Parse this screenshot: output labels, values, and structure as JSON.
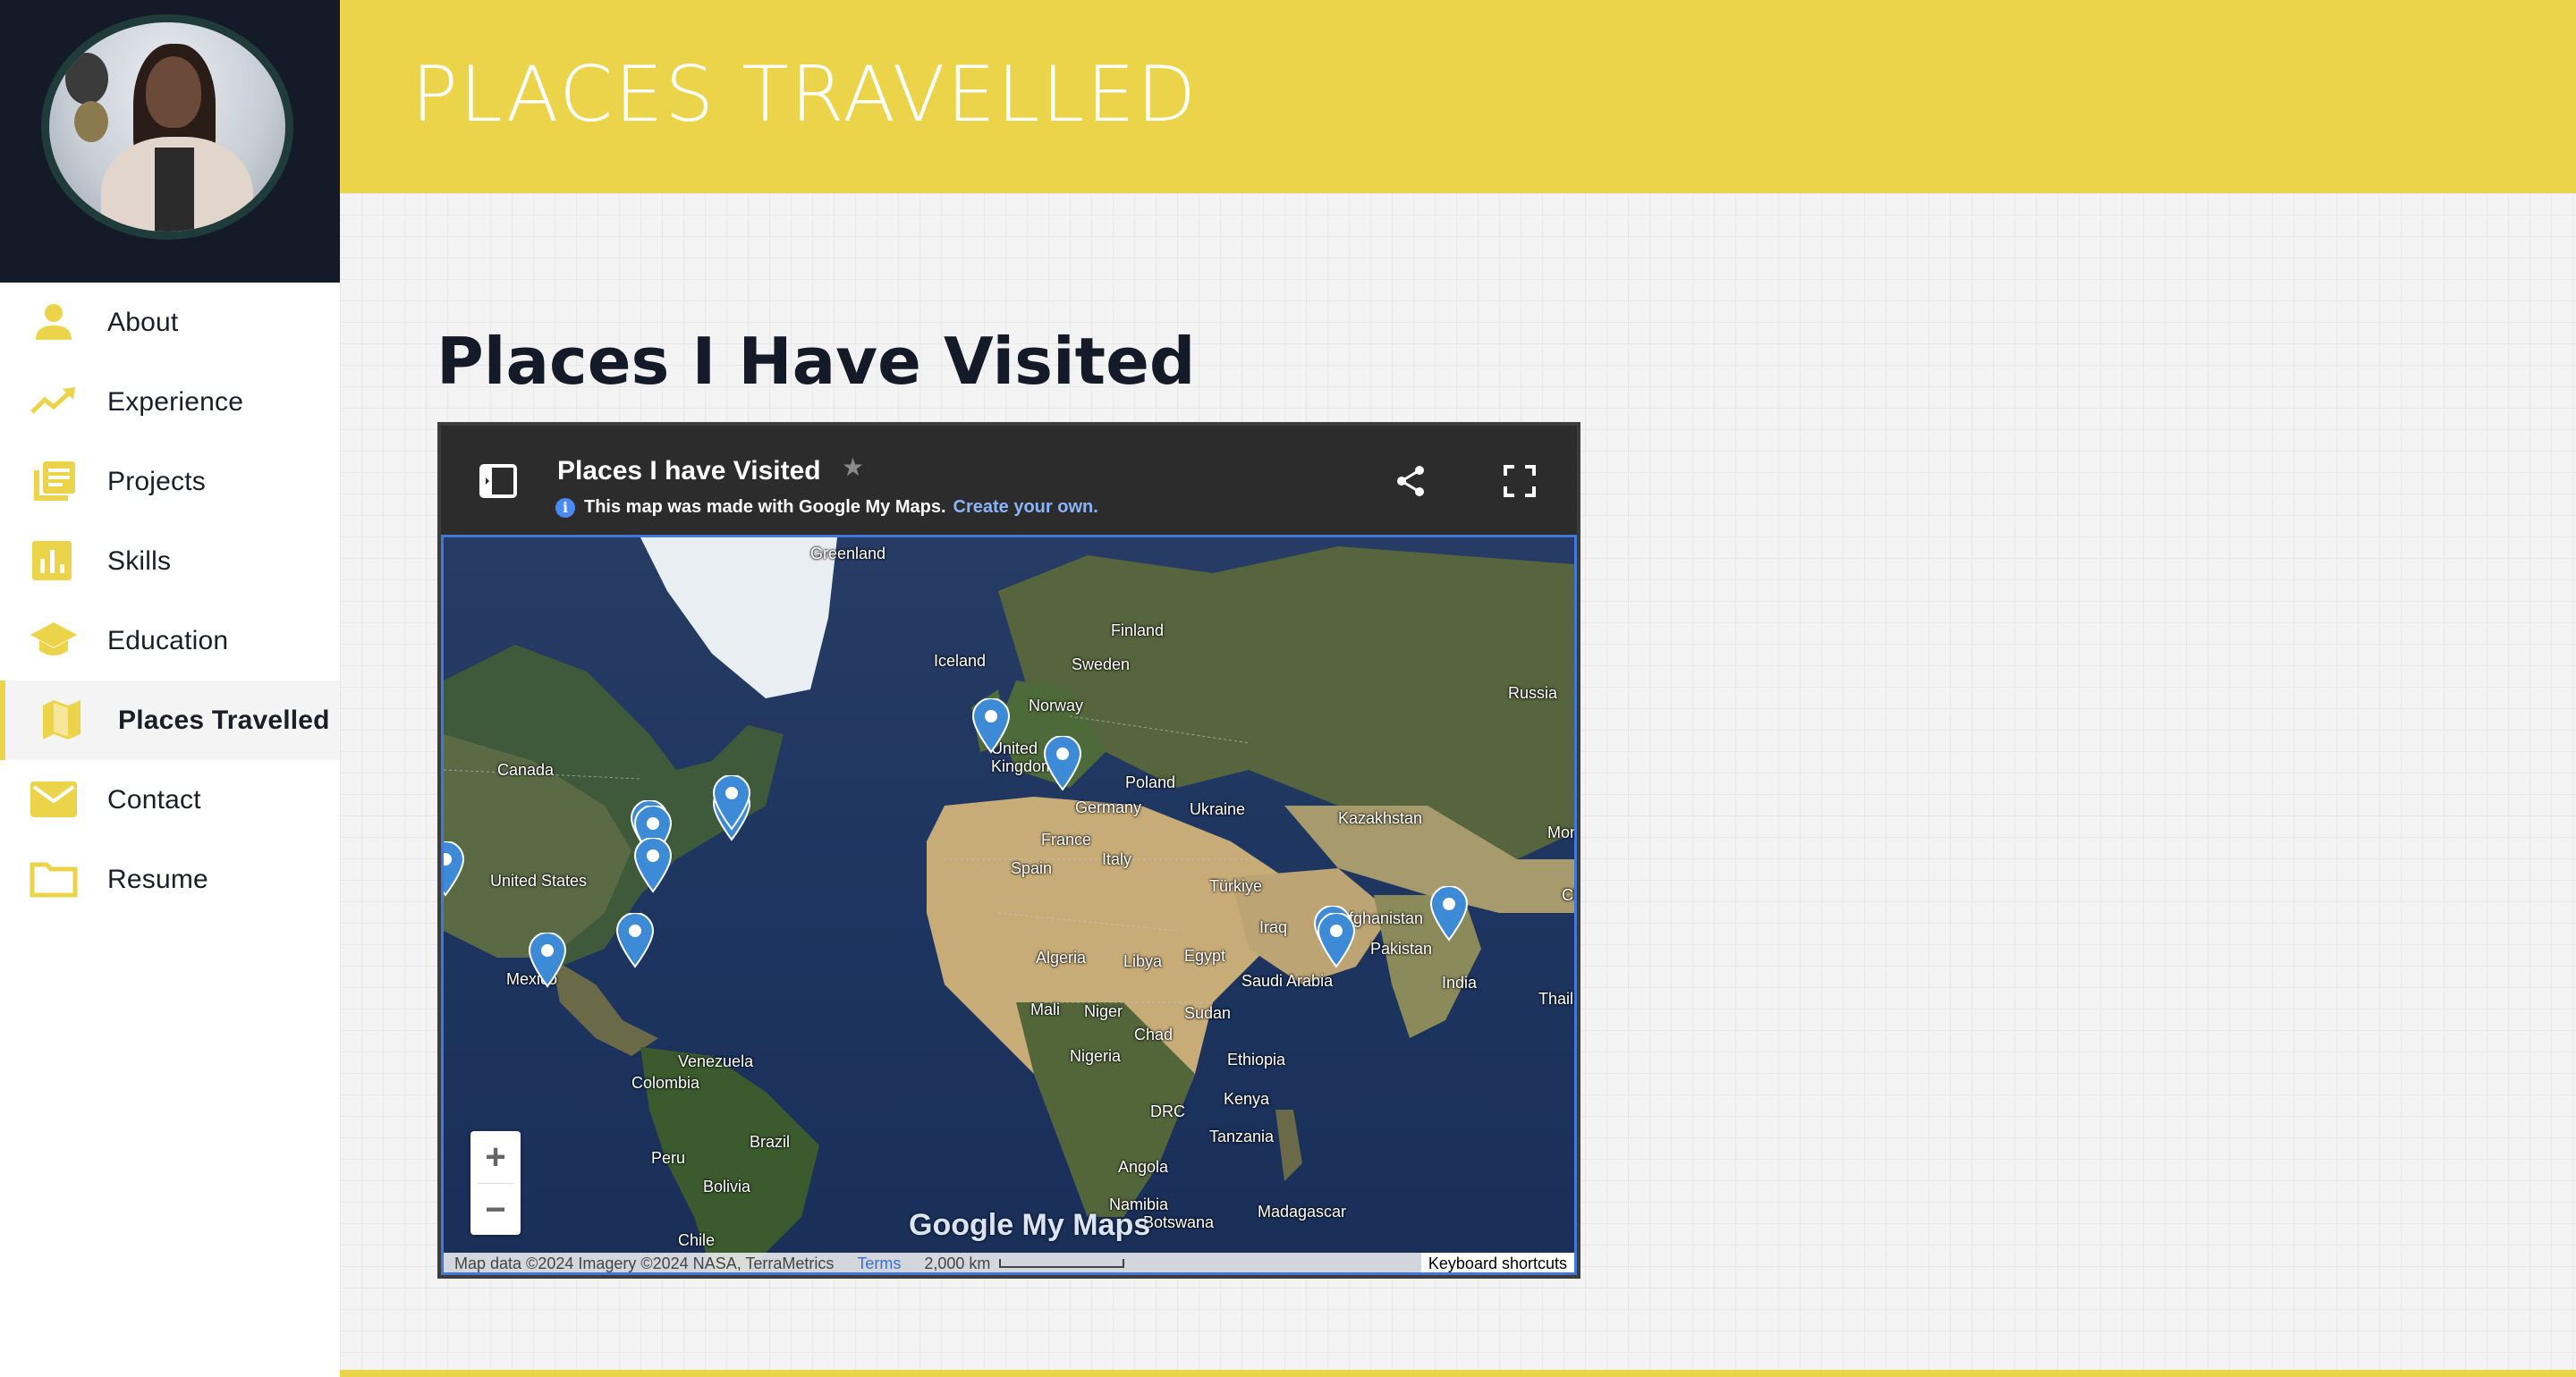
{
  "header": {
    "title": "PLACES TRAVELLED"
  },
  "sidebar": {
    "items": [
      {
        "label": "About",
        "icon": "person-icon"
      },
      {
        "label": "Experience",
        "icon": "trending-up-icon"
      },
      {
        "label": "Projects",
        "icon": "library-books-icon"
      },
      {
        "label": "Skills",
        "icon": "bar-chart-icon"
      },
      {
        "label": "Education",
        "icon": "school-icon"
      },
      {
        "label": "Places Travelled",
        "icon": "map-icon",
        "active": true
      },
      {
        "label": "Contact",
        "icon": "mail-icon"
      },
      {
        "label": "Resume",
        "icon": "folder-icon"
      }
    ]
  },
  "main": {
    "section_title": "Places I Have Visited"
  },
  "map": {
    "title": "Places I have Visited",
    "star": "★",
    "info_text": "This map was made with Google My Maps.",
    "create_link": "Create your own.",
    "logo_text": "Google My Maps",
    "attribution": "Map data ©2024 Imagery ©2024 NASA, TerraMetrics",
    "terms": "Terms",
    "scale": "2,000 km",
    "keyboard_shortcuts": "Keyboard shortcuts",
    "zoom_in": "+",
    "zoom_out": "−",
    "labels": [
      "Greenland",
      "Iceland",
      "Finland",
      "Sweden",
      "Norway",
      "Russia",
      "United Kingdom",
      "Poland",
      "Germany",
      "Ukraine",
      "France",
      "Italy",
      "Spain",
      "Kazakhstan",
      "Türkiye",
      "Canada",
      "United States",
      "Iraq",
      "Afghanistan",
      "Pakistan",
      "Algeria",
      "Libya",
      "Egypt",
      "Saudi Arabia",
      "India",
      "Mexico",
      "Mali",
      "Niger",
      "Sudan",
      "Chad",
      "Nigeria",
      "Ethiopia",
      "Venezuela",
      "Colombia",
      "Kenya",
      "DRC",
      "Tanzania",
      "Brazil",
      "Peru",
      "Angola",
      "Bolivia",
      "Namibia",
      "Botswana",
      "Madagascar",
      "Chile",
      "Thailand",
      "Mongolia",
      "China"
    ]
  },
  "colors": {
    "accent": "#ecd44a",
    "sidebar_dark": "#151a28",
    "pin": "#3d8ad6"
  }
}
